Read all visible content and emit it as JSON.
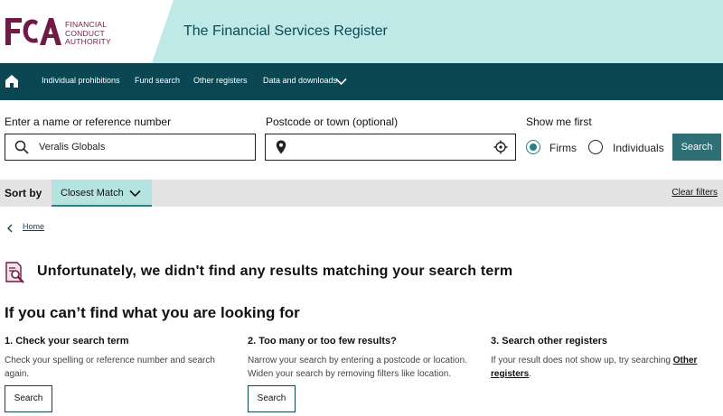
{
  "header": {
    "logo_letters": "FCA",
    "logo_lines": [
      "FINANCIAL",
      "CONDUCT",
      "AUTHORITY"
    ],
    "site_title": "The Financial Services Register"
  },
  "nav": {
    "items": [
      "Individual prohibitions",
      "Fund search",
      "Other registers",
      "Data and downloads"
    ]
  },
  "search": {
    "name_label": "Enter a name or reference number",
    "name_value": "Veralis Globals",
    "postcode_label": "Postcode or town (optional)",
    "postcode_value": "",
    "show_me_first_label": "Show me first",
    "options": [
      {
        "label": "Firms",
        "selected": true
      },
      {
        "label": "Individuals",
        "selected": false
      }
    ],
    "button_label": "Search"
  },
  "sort": {
    "label": "Sort by",
    "selected": "Closest Match",
    "clear_filters": "Clear filters"
  },
  "breadcrumb": {
    "home": "Home"
  },
  "no_results": {
    "message": "Unfortunately, we didn't find any results matching your search term"
  },
  "help": {
    "title": "If you can’t find what you are looking for",
    "columns": [
      {
        "heading": "1. Check your search term",
        "text": "Check your spelling or reference number and search again.",
        "button": "Search"
      },
      {
        "heading": "2. Too many or too few results?",
        "text": "Narrow your search by entering a postcode or location. Widen your search by removing filters like location.",
        "button": "Search"
      },
      {
        "heading": "3. Search other registers",
        "text_before": "If your result does not show up, try searching ",
        "link": "Other registers",
        "text_after": "."
      }
    ]
  },
  "colors": {
    "brand_purple": "#701b45",
    "header_band": "#bfe9e6",
    "nav_bg": "#0b4752",
    "accent_teal": "#2b7f86",
    "sort_select_bg": "#b5e3df"
  },
  "icons": [
    "home-icon",
    "chevron-down-icon",
    "search-icon",
    "location-pin-icon",
    "locate-crosshair-icon",
    "chevron-left-icon",
    "document-search-icon"
  ]
}
